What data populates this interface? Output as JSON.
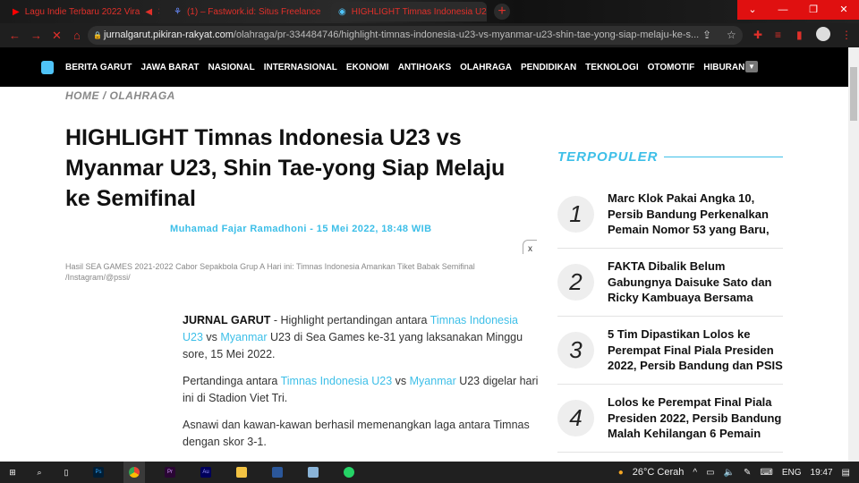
{
  "browser": {
    "tabs": [
      {
        "title": "Lagu Indie Terbaru 2022 Vira",
        "icon": "youtube-icon",
        "audio": "speaker-icon"
      },
      {
        "title": "(1) – Fastwork.id: Situs Freelance",
        "icon": "fastwork-icon"
      },
      {
        "title": "HIGHLIGHT Timnas Indonesia U2",
        "icon": "site-icon"
      }
    ],
    "url_host": "jurnalgarut.pikiran-rakyat.com",
    "url_path": "/olahraga/pr-334484746/highlight-timnas-indonesia-u23-vs-myanmar-u23-shin-tae-yong-siap-melaju-ke-s..."
  },
  "nav": {
    "items": [
      "BERITA GARUT",
      "JAWA BARAT",
      "NASIONAL",
      "INTERNASIONAL",
      "EKONOMI",
      "ANTIHOAKS",
      "OLAHRAGA",
      "PENDIDIKAN",
      "TEKNOLOGI",
      "OTOMOTIF",
      "HIBURAN"
    ]
  },
  "article": {
    "breadcrumb": "HOME / OLAHRAGA",
    "title": "HIGHLIGHT Timnas Indonesia U23 vs Myanmar U23, Shin Tae-yong Siap Melaju ke Semifinal",
    "byline": "Muhamad Fajar Ramadhoni - 15 Mei 2022, 18:48 WIB",
    "close": "x",
    "caption": "Hasil SEA GAMES 2021-2022 Cabor Sepakbola Grup A Hari ini: Timnas Indonesia Amankan Tiket Babak Semifinal /Instagram/@pssi/",
    "p1": {
      "lead": "JURNAL GARUT",
      "a": " - Highlight pertandingan antara ",
      "l1": "Timnas Indonesia U23",
      "b": " vs ",
      "l2": "Myanmar",
      "c": " U23 di Sea Games ke-31 yang laksanakan Minggu sore, 15 Mei 2022."
    },
    "p2": {
      "a": "Pertandinga antara ",
      "l1": "Timnas Indonesia U23",
      "b": " vs ",
      "l2": "Myanmar",
      "c": " U23 digelar hari ini di Stadion Viet Tri."
    },
    "p3": "Asnawi dan kawan-kawan berhasil memenangkan laga antara Timnas dengan skor 3-1."
  },
  "sidebar": {
    "heading": "TERPOPULER",
    "items": [
      {
        "num": "1",
        "title": "Marc Klok Pakai Angka 10, Persib Bandung Perkenalkan Pemain Nomor 53 yang Baru,"
      },
      {
        "num": "2",
        "title": "FAKTA Dibalik Belum Gabungnya Daisuke Sato dan Ricky Kambuaya Bersama"
      },
      {
        "num": "3",
        "title": "5 Tim Dipastikan Lolos ke Perempat Final Piala Presiden 2022, Persib Bandung dan PSIS"
      },
      {
        "num": "4",
        "title": "Lolos ke Perempat Final Piala Presiden 2022, Persib Bandung Malah Kehilangan 6 Pemain"
      }
    ]
  },
  "taskbar": {
    "weather": "26°C  Cerah",
    "lang": "ENG",
    "time": "19:47",
    "apps": [
      "Ps",
      "Chrome",
      "Pr",
      "Au",
      "Files",
      "Word",
      "Notes",
      "WhatsApp"
    ]
  }
}
